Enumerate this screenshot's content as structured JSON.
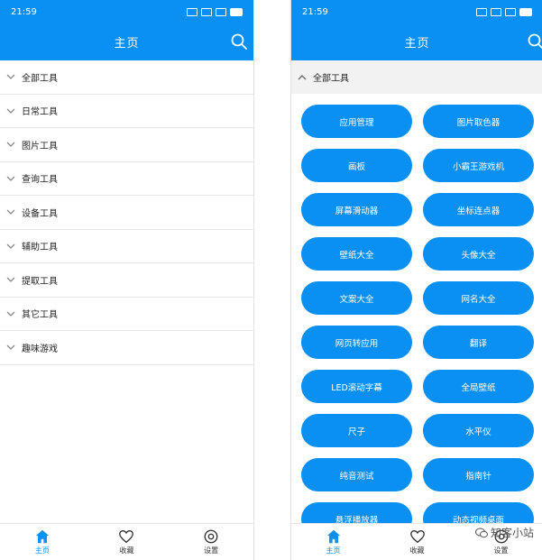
{
  "status": {
    "time": "21:59"
  },
  "appbar": {
    "title": "主页"
  },
  "categories": [
    "全部工具",
    "日常工具",
    "图片工具",
    "查询工具",
    "设备工具",
    "辅助工具",
    "提取工具",
    "其它工具",
    "趣味游戏"
  ],
  "expanded": {
    "title": "全部工具",
    "tools": [
      "应用管理",
      "图片取色器",
      "画板",
      "小霸王游戏机",
      "屏幕滑动器",
      "坐标连点器",
      "壁纸大全",
      "头像大全",
      "文案大全",
      "网名大全",
      "网页转应用",
      "翻译",
      "LED滚动字幕",
      "全局壁纸",
      "尺子",
      "水平仪",
      "纯音测试",
      "指南针",
      "悬浮播放器",
      "动态视频桌面"
    ]
  },
  "nav": {
    "home": "主页",
    "favorites": "收藏",
    "settings": "设置"
  },
  "watermark": "知客小站",
  "colors": {
    "accent": "#0a8ff3"
  }
}
